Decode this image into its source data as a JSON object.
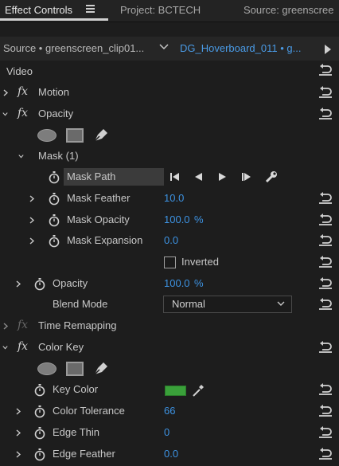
{
  "tabs": {
    "effect_controls": "Effect Controls",
    "project": "Project: BCTECH",
    "source": "Source: greenscree"
  },
  "source_bar": {
    "left": "Source • greenscreen_clip01...",
    "right": "DG_Hoverboard_011 • g..."
  },
  "section": {
    "video": "Video"
  },
  "effects": {
    "motion": "Motion",
    "opacity": "Opacity",
    "mask": "Mask (1)",
    "mask_path": "Mask Path",
    "mask_feather": {
      "label": "Mask Feather",
      "value": "10.0"
    },
    "mask_opacity": {
      "label": "Mask Opacity",
      "value": "100.0",
      "unit": "%"
    },
    "mask_expansion": {
      "label": "Mask Expansion",
      "value": "0.0"
    },
    "inverted": "Inverted",
    "opacity_prop": {
      "label": "Opacity",
      "value": "100.0",
      "unit": "%"
    },
    "blend_mode": {
      "label": "Blend Mode",
      "value": "Normal"
    },
    "time_remapping": "Time Remapping",
    "color_key": "Color Key",
    "key_color": {
      "label": "Key Color",
      "swatch": "#3aa03a"
    },
    "color_tolerance": {
      "label": "Color Tolerance",
      "value": "66"
    },
    "edge_thin": {
      "label": "Edge Thin",
      "value": "0"
    },
    "edge_feather": {
      "label": "Edge Feather",
      "value": "0.0"
    }
  },
  "colors": {
    "accent": "#3d93e3",
    "bg": "#1d1d1d"
  }
}
